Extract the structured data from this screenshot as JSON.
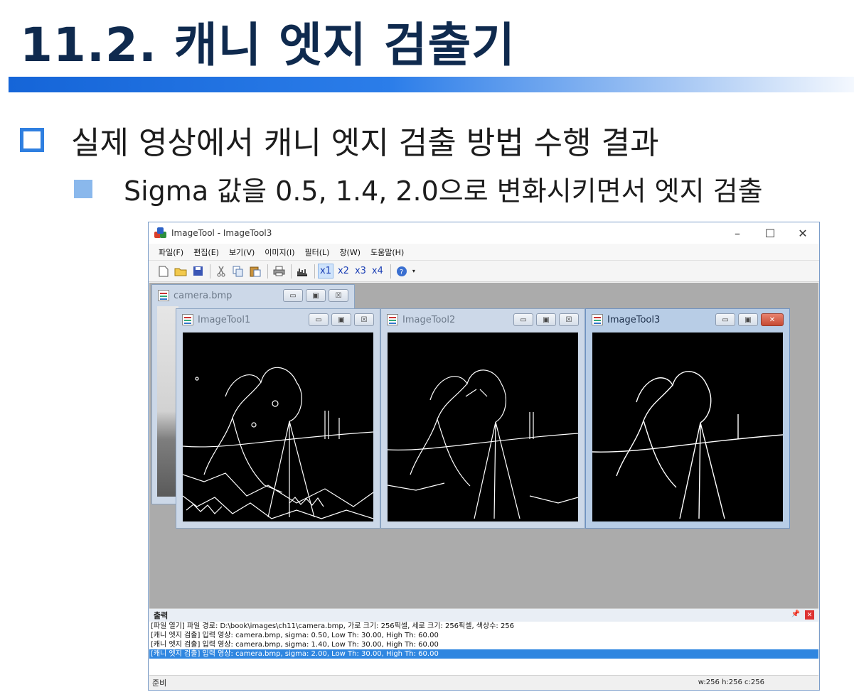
{
  "slide": {
    "title": "11.2. 캐니 엣지 검출기",
    "bullet_main": "실제 영상에서 캐니 엣지 검출 방법 수행 결과",
    "bullet_sub": "Sigma 값을 0.5, 1.4, 2.0으로 변화시키면서 엣지 검출"
  },
  "app": {
    "title": "ImageTool - ImageTool3",
    "window_controls": [
      "–",
      "☐",
      "✕"
    ],
    "menu": [
      "파일(F)",
      "편집(E)",
      "보기(V)",
      "이미지(I)",
      "필터(L)",
      "창(W)",
      "도움말(H)"
    ],
    "zoom_buttons": [
      "x1",
      "x2",
      "x3",
      "x4"
    ],
    "active_zoom": "x1",
    "toolbar_icons": [
      "new-icon",
      "open-icon",
      "save-icon",
      "cut-icon",
      "copy-icon",
      "paste-icon",
      "print-icon",
      "histogram-icon",
      "help-icon"
    ],
    "child_windows": [
      "camera.bmp",
      "ImageTool1",
      "ImageTool2",
      "ImageTool3"
    ],
    "output": {
      "header": "출력",
      "lines": [
        "[파일 열기] 파일 경로: D:\\book\\images\\ch11\\camera.bmp, 가로 크기: 256픽셀, 세로 크기: 256픽셀, 색상수: 256",
        "[캐니 엣지 검출] 입력 영상: camera.bmp, sigma: 0.50, Low Th: 30.00, High Th: 60.00",
        "[캐니 엣지 검출] 입력 영상: camera.bmp, sigma: 1.40, Low Th: 30.00, High Th: 60.00",
        "[캐니 엣지 검출] 입력 영상: camera.bmp, sigma: 2.00, Low Th: 30.00, High Th: 60.00"
      ],
      "selected_line": 3
    },
    "status": {
      "left": "준비",
      "right": "w:256  h:256  c:256"
    }
  }
}
